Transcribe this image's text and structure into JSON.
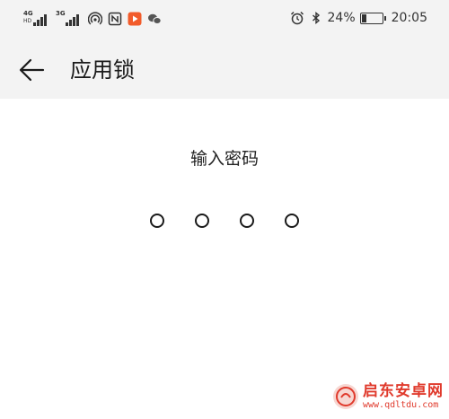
{
  "status_bar": {
    "signal_1": {
      "network": "4G",
      "label": "HD"
    },
    "signal_2": {
      "network": "3G",
      "label": ""
    },
    "icons": [
      "hotspot-icon",
      "nfc-icon",
      "video-app-icon",
      "wechat-icon"
    ],
    "right_icons": [
      "alarm-icon",
      "bluetooth-icon"
    ],
    "battery_percent": "24%",
    "battery_level": 0.24,
    "time": "20:05"
  },
  "toolbar": {
    "back_icon": "arrow-left-icon",
    "title": "应用锁"
  },
  "lock": {
    "prompt": "输入密码",
    "pin_length": 4,
    "entered": 0
  },
  "watermark": {
    "title": "启东安卓网",
    "url": "www.qdltdu.com",
    "accent": "#e03a2c"
  },
  "colors": {
    "header_bg": "#f3f3f3",
    "page_bg": "#ffffff",
    "text": "#1a1a1a"
  }
}
